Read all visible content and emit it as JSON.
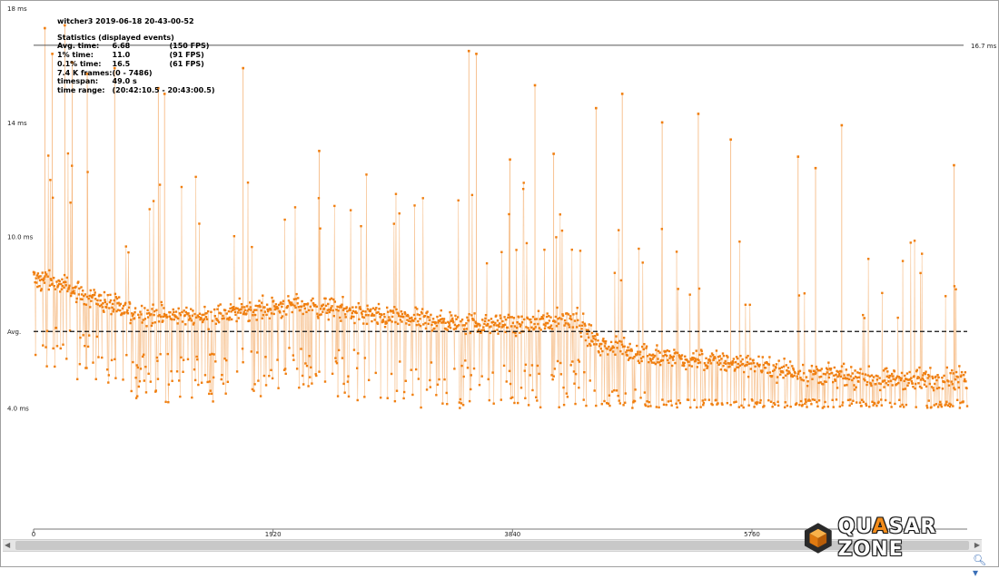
{
  "stats": {
    "title": "witcher3 2019-06-18 20-43-00-52",
    "heading": "Statistics (displayed events)",
    "rows": [
      {
        "label": "Avg. time:",
        "value": "6.68",
        "extra": "(150 FPS)"
      },
      {
        "label": "1% time:",
        "value": "11.0",
        "extra": "(91 FPS)"
      },
      {
        "label": "0.1% time:",
        "value": "16.5",
        "extra": "(61 FPS)"
      },
      {
        "label": "7.4 K frames:",
        "value": "(0 - 7486)",
        "extra": ""
      },
      {
        "label": "timespan:",
        "value": "49.0 s",
        "extra": ""
      },
      {
        "label": "time range:",
        "value": "(20:42:10.5 - 20:43:00.5)",
        "extra": ""
      }
    ]
  },
  "logo": {
    "text_a": "QU",
    "text_b": "A",
    "text_c": "SAR ZONE"
  },
  "chart_data": {
    "type": "scatter",
    "color": "#f07f10",
    "xlim": [
      0,
      7486
    ],
    "ylim": [
      3.7,
      18
    ],
    "y_ticks": [
      {
        "value": 18,
        "label": "18 ms"
      },
      {
        "value": 14,
        "label": "14 ms"
      },
      {
        "value": 10,
        "label": "10.0 ms"
      },
      {
        "value": 6.68,
        "label": "Avg."
      },
      {
        "value": 4,
        "label": "4.0 ms"
      }
    ],
    "x_ticks": [
      {
        "value": 0,
        "label": "0"
      },
      {
        "value": 1920,
        "label": "1920"
      },
      {
        "value": 3840,
        "label": "3840"
      },
      {
        "value": 5760,
        "label": "5760"
      }
    ],
    "ref_line": {
      "value": 16.7,
      "label": "16.7 ms"
    },
    "avg_line": {
      "value": 6.68
    },
    "trend_x": [
      0,
      400,
      800,
      1400,
      1800,
      2200,
      2800,
      3400,
      4000,
      4350,
      4500,
      5000,
      5600,
      6200,
      6800,
      7486
    ],
    "trend_y": [
      8.6,
      8.0,
      7.3,
      7.2,
      7.5,
      7.6,
      7.2,
      7.0,
      6.9,
      7.2,
      6.3,
      5.8,
      5.6,
      5.2,
      5.0,
      5.0
    ],
    "spikes": [
      {
        "x": 90,
        "y": 17.3
      },
      {
        "x": 150,
        "y": 16.4
      },
      {
        "x": 250,
        "y": 17.4
      },
      {
        "x": 310,
        "y": 16.1
      },
      {
        "x": 430,
        "y": 15.7
      },
      {
        "x": 650,
        "y": 15.9
      },
      {
        "x": 1000,
        "y": 15.2
      },
      {
        "x": 1050,
        "y": 15.0
      },
      {
        "x": 1680,
        "y": 15.9
      },
      {
        "x": 3490,
        "y": 16.5
      },
      {
        "x": 3550,
        "y": 16.4
      },
      {
        "x": 4020,
        "y": 15.3
      },
      {
        "x": 4510,
        "y": 14.5
      },
      {
        "x": 4720,
        "y": 15.0
      },
      {
        "x": 5040,
        "y": 14.0
      },
      {
        "x": 5330,
        "y": 14.3
      },
      {
        "x": 5590,
        "y": 13.4
      },
      {
        "x": 6480,
        "y": 13.9
      },
      {
        "x": 7380,
        "y": 12.5
      },
      {
        "x": 2290,
        "y": 13.0
      },
      {
        "x": 3820,
        "y": 12.7
      },
      {
        "x": 4170,
        "y": 12.9
      },
      {
        "x": 6130,
        "y": 12.8
      },
      {
        "x": 6270,
        "y": 12.4
      }
    ]
  }
}
